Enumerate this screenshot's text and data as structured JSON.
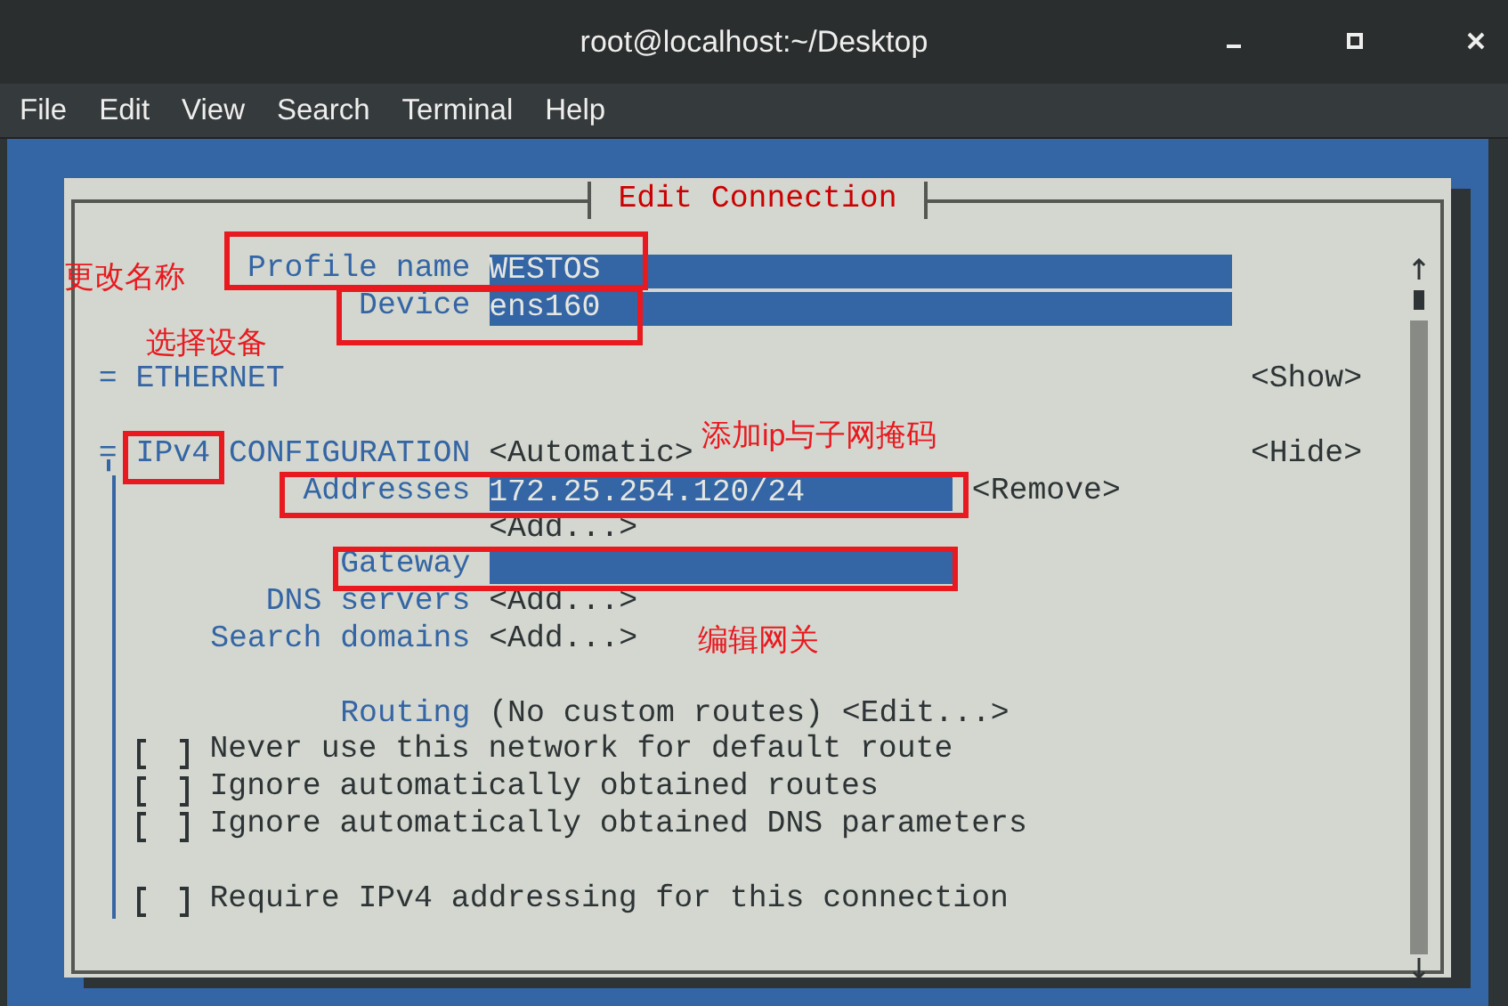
{
  "window": {
    "title": "root@localhost:~/Desktop"
  },
  "menu": [
    "File",
    "Edit",
    "View",
    "Search",
    "Terminal",
    "Help"
  ],
  "dialog": {
    "title": "Edit Connection",
    "fields": [
      {
        "label": "Profile name",
        "value": "WESTOS",
        "highlighted": true
      },
      {
        "label": "Device",
        "value": "ens160",
        "highlighted": true
      }
    ],
    "sections": [
      {
        "marker": "=",
        "title": "ETHERNET",
        "toggle": "<Show>",
        "expanded": false
      },
      {
        "marker": "=",
        "title": "IPv4",
        "title_rest": "CONFIGURATION",
        "value": "<Automatic>",
        "toggle": "<Hide>",
        "expanded": true,
        "title_highlighted": true,
        "groups": [
          [
            {
              "kind": "field",
              "label": "Addresses",
              "value": "172.25.254.120/24",
              "button": "<Remove>",
              "highlighted": true
            },
            {
              "kind": "button",
              "button": "<Add...>"
            },
            {
              "kind": "field",
              "label": "Gateway",
              "highlighted": true
            },
            {
              "kind": "button",
              "label": "DNS servers",
              "button": "<Add...>"
            },
            {
              "kind": "button",
              "label": "Search domains",
              "button": "<Add...>"
            }
          ],
          [
            {
              "kind": "routing",
              "label": "Routing",
              "text": "(No custom routes)",
              "button": "<Edit...>"
            },
            {
              "kind": "checkbox",
              "checked": false,
              "text": "Never use this network for default route"
            },
            {
              "kind": "checkbox",
              "checked": false,
              "text": "Ignore automatically obtained routes"
            },
            {
              "kind": "checkbox",
              "checked": false,
              "text": "Ignore automatically obtained DNS parameters"
            }
          ],
          [
            {
              "kind": "checkbox",
              "checked": false,
              "text": "Require IPv4 addressing for this connection"
            }
          ]
        ]
      }
    ]
  },
  "annotations": [
    {
      "text": "更改名称"
    },
    {
      "text": "选择设备"
    },
    {
      "text": "添加ip与子网掩码"
    },
    {
      "text": "编辑网关"
    }
  ]
}
